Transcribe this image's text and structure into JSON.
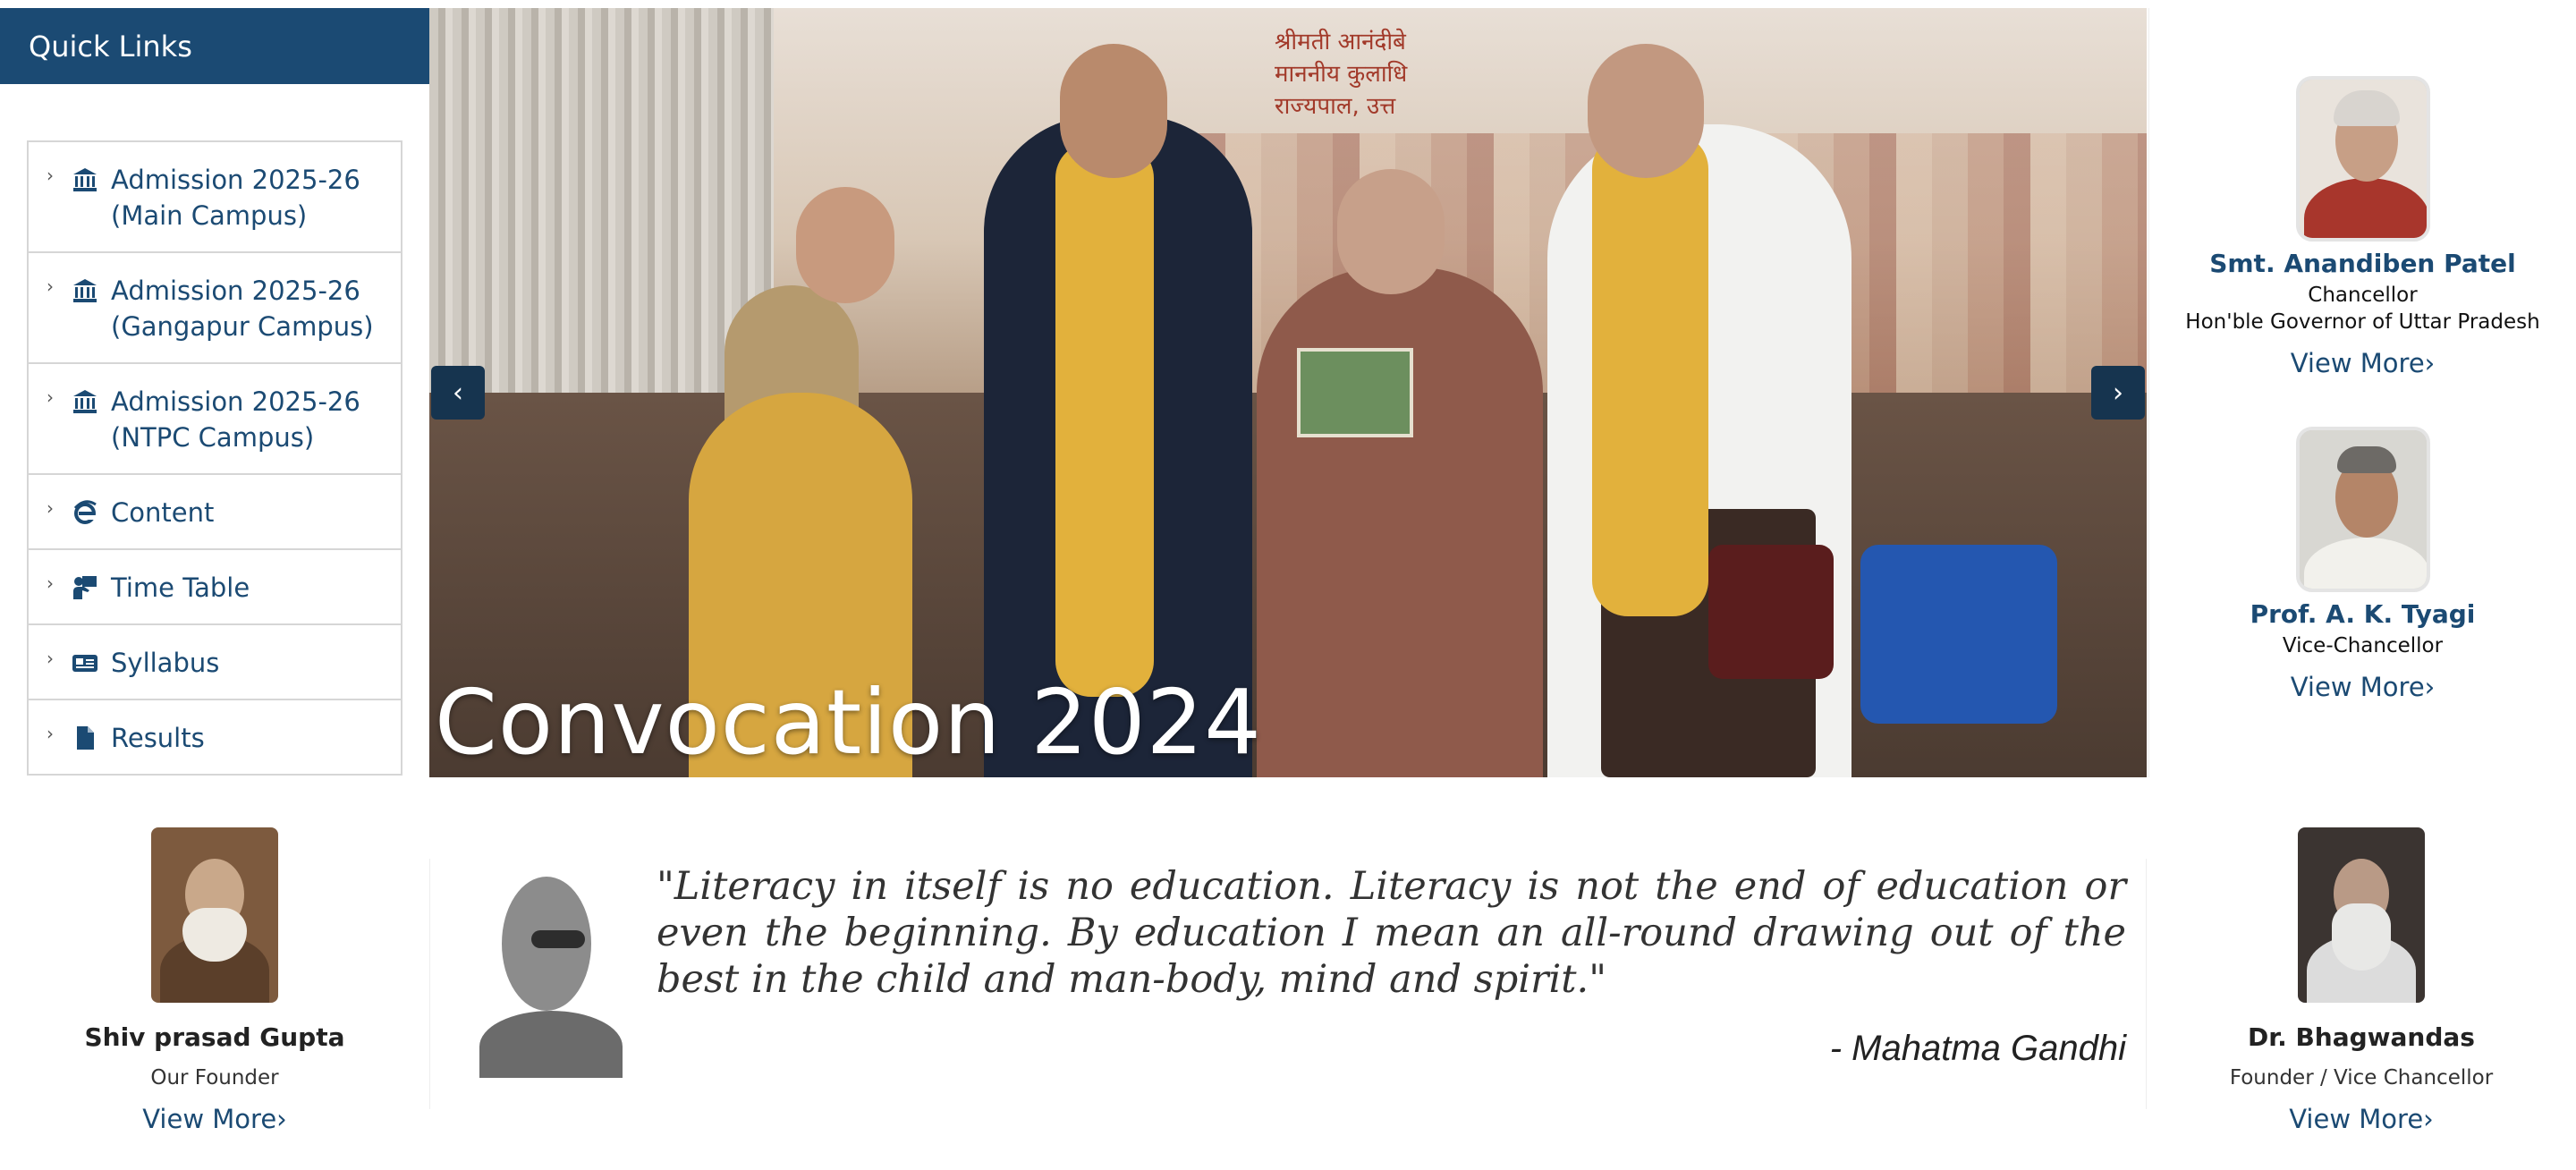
{
  "quick_links": {
    "title": "Quick Links",
    "items": [
      {
        "label": "Admission 2025-26 (Main Campus)",
        "icon": "bank-icon"
      },
      {
        "label": "Admission 2025-26 (Gangapur Campus)",
        "icon": "bank-icon"
      },
      {
        "label": "Admission 2025-26 (NTPC Campus)",
        "icon": "bank-icon"
      },
      {
        "label": "Content",
        "icon": "internet-explorer-icon"
      },
      {
        "label": "Time Table",
        "icon": "teacher-icon"
      },
      {
        "label": "Syllabus",
        "icon": "id-card-icon"
      },
      {
        "label": "Results",
        "icon": "file-icon"
      }
    ]
  },
  "carousel": {
    "caption": "Convocation 2024",
    "banner_text_line1": "श्रीमती आनंदीबे",
    "banner_text_line2": "माननीय कुलाधि",
    "banner_text_line3": "राज्यपाल, उत्त",
    "prev_label": "‹",
    "next_label": "›"
  },
  "leaders": [
    {
      "name": "Smt. Anandiben Patel",
      "role_line1": "Chancellor",
      "role_line2": "Hon'ble Governor of Uttar Pradesh",
      "more": "View More›"
    },
    {
      "name": "Prof. A. K. Tyagi",
      "role_line1": "Vice-Chancellor",
      "role_line2": "",
      "more": "View More›"
    }
  ],
  "founders": [
    {
      "name": "Shiv prasad Gupta",
      "role": "Our Founder",
      "more": "View More›"
    },
    {
      "name": "Dr. Bhagwandas",
      "role": "Founder / Vice Chancellor",
      "more": "View More›"
    }
  ],
  "quote": {
    "text": "\"Literacy in itself is no education. Literacy is not the end of education or even the beginning. By education I mean an all-round drawing out of the best in the child and man-body, mind and spirit.\"",
    "author": "- Mahatma Gandhi"
  },
  "colors": {
    "brand": "#1b4a73",
    "control": "#16344f"
  }
}
